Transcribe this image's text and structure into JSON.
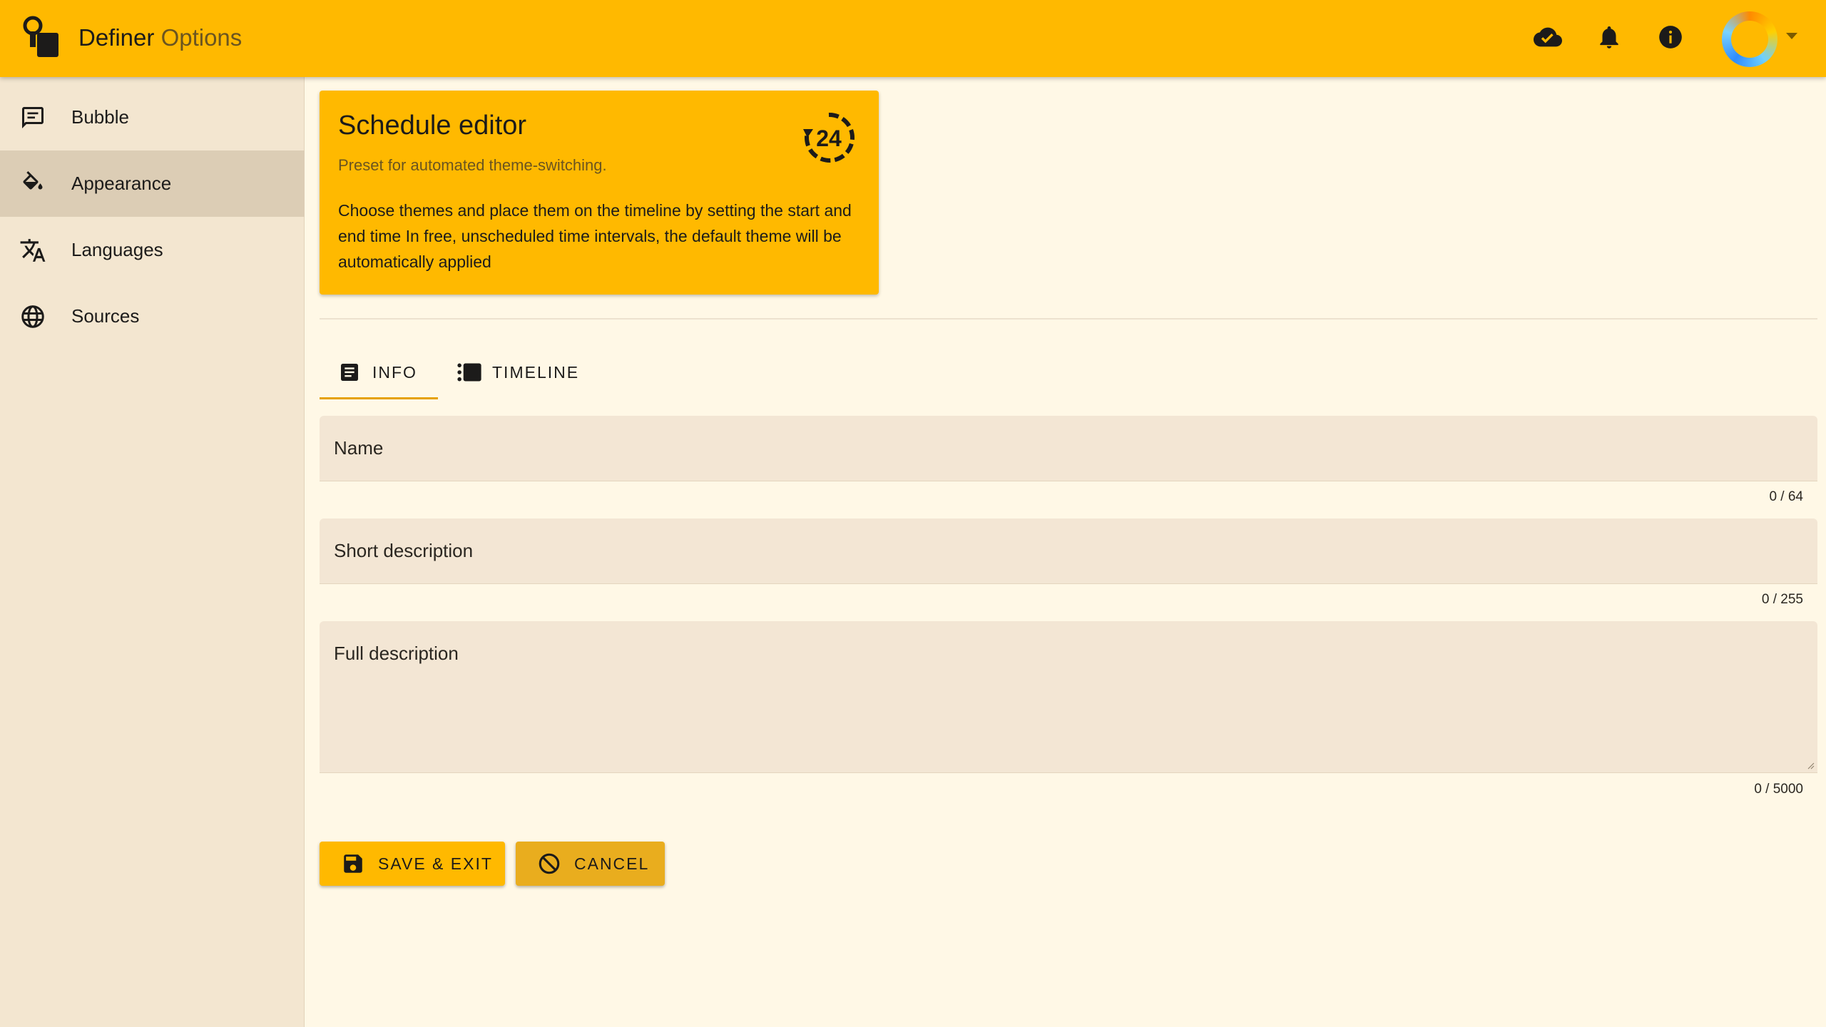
{
  "app": {
    "title_main": "Definer",
    "title_secondary": "Options"
  },
  "header": {
    "icons": [
      "cloud-done-icon",
      "bell-icon",
      "info-icon"
    ]
  },
  "sidebar": {
    "items": [
      {
        "label": "Bubble",
        "icon": "chat-bubble-icon",
        "active": false
      },
      {
        "label": "Appearance",
        "icon": "paint-bucket-icon",
        "active": true
      },
      {
        "label": "Languages",
        "icon": "translate-icon",
        "active": false
      },
      {
        "label": "Sources",
        "icon": "globe-icon",
        "active": false
      }
    ]
  },
  "card": {
    "title": "Schedule editor",
    "subtitle": "Preset for automated theme-switching.",
    "body": "Choose themes and place them on the timeline by setting the start and end time In free, unscheduled time intervals, the default theme will be automatically applied",
    "icon": "24-hours-icon"
  },
  "tabs": [
    {
      "label": "INFO",
      "icon": "article-icon",
      "active": true
    },
    {
      "label": "TIMELINE",
      "icon": "timeline-icon",
      "active": false
    }
  ],
  "form": {
    "name": {
      "label": "Name",
      "value": "",
      "counter": "0 / 64"
    },
    "short_description": {
      "label": "Short description",
      "value": "",
      "counter": "0 / 255"
    },
    "full_description": {
      "label": "Full description",
      "value": "",
      "counter": "0 / 5000"
    }
  },
  "actions": {
    "save_label": "SAVE & EXIT",
    "cancel_label": "CANCEL"
  },
  "colors": {
    "accent": "#ffb900",
    "sidebar_bg": "#f3e6d0",
    "page_bg": "#fff8e6",
    "tab_underline": "#e6a100"
  }
}
